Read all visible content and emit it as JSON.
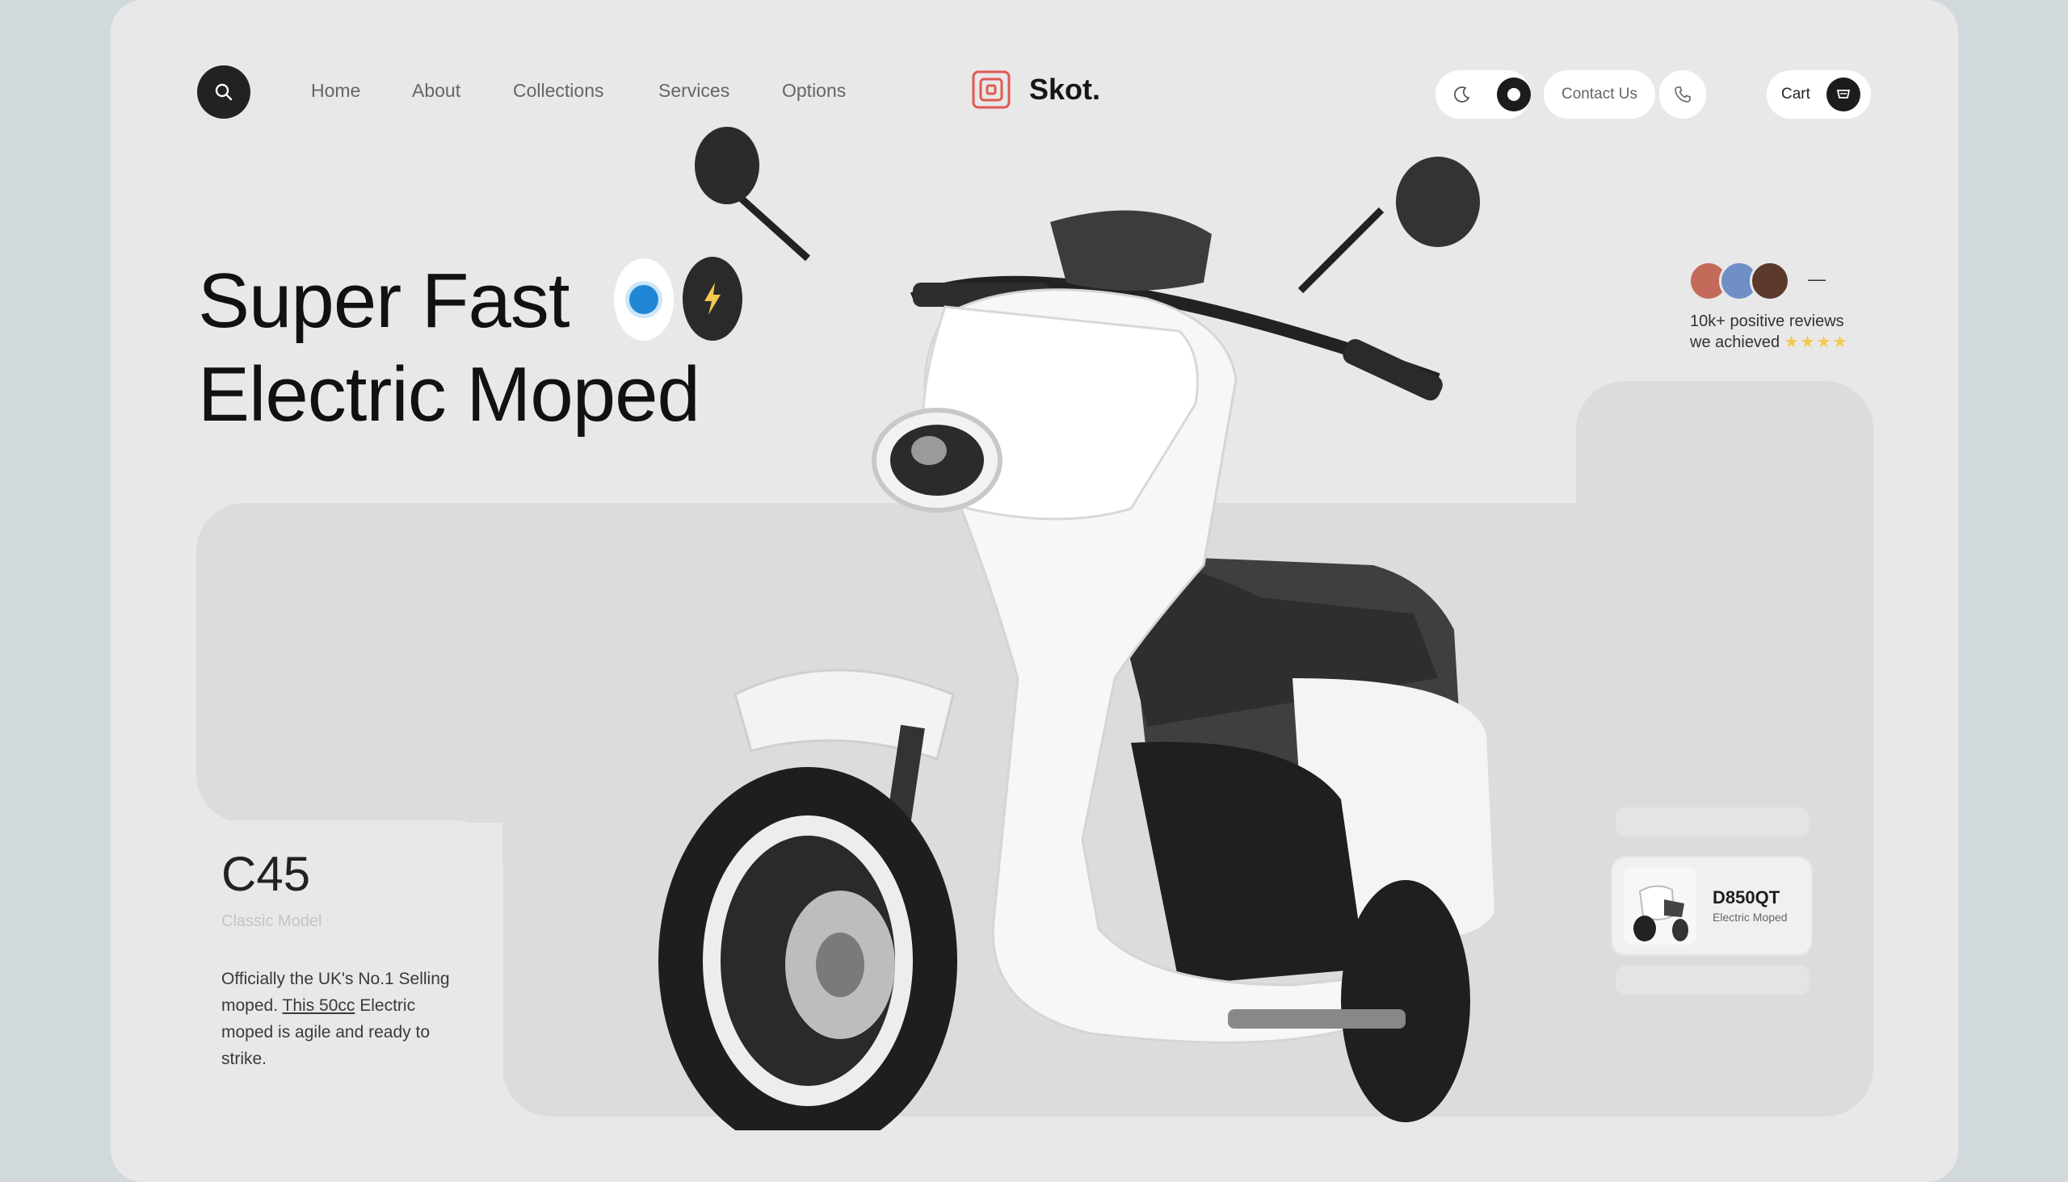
{
  "nav": {
    "links": [
      "Home",
      "About",
      "Collections",
      "Services",
      "Options"
    ],
    "brand": "Skot.",
    "contact_label": "Contact Us",
    "cart_label": "Cart"
  },
  "hero": {
    "line1": "Super Fast",
    "line2": "Electric Moped"
  },
  "reviews": {
    "line1": "10k+ positive reviews",
    "line2": "we achieved",
    "stars": "★★★★",
    "dash": "—"
  },
  "model": {
    "code": "C45",
    "subtitle": "Classic Model",
    "desc_start": "Officially the UK's No.1 Selling moped.",
    "desc_link": "This 50cc",
    "desc_end": "Electric moped is agile and ready to strike."
  },
  "mini_product": {
    "title": "D850QT",
    "subtitle": "Electric Moped"
  },
  "colors": {
    "page_bg": "#e8e8e8",
    "outer_bg": "#d2d9dc",
    "dark": "#1c1c1c",
    "accent_blue": "#1f87d6",
    "accent_yellow": "#f2c94c",
    "logo_red": "#e05a52"
  },
  "icons": {
    "search": "search-icon",
    "moon": "moon-icon",
    "phone": "phone-icon",
    "cart": "cart-icon",
    "bolt": "lightning-icon"
  }
}
